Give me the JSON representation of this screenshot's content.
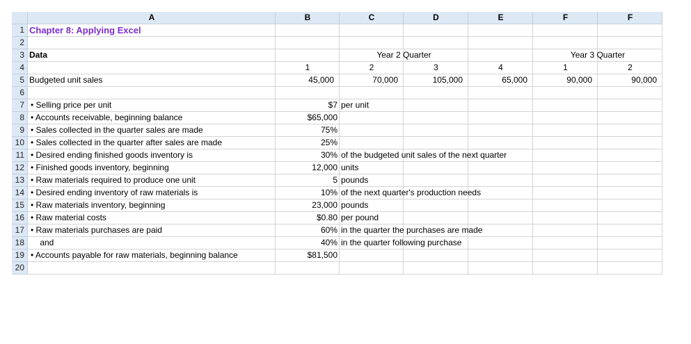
{
  "column_headers": [
    "A",
    "B",
    "C",
    "D",
    "E",
    "F",
    "F"
  ],
  "title": "Chapter 8: Applying Excel",
  "data_label": "Data",
  "year2_label": "Year 2 Quarter",
  "year3_label": "Year 3 Quarter",
  "quarters": [
    "1",
    "2",
    "3",
    "4",
    "1",
    "2"
  ],
  "budgeted_label": "Budgeted unit sales",
  "budgeted_sales": [
    "45,000",
    "70,000",
    "105,000",
    "65,000",
    "90,000",
    "90,000"
  ],
  "items": [
    {
      "row": "7",
      "label": "• Selling price per unit",
      "value": "$7",
      "note": "per unit"
    },
    {
      "row": "8",
      "label": "• Accounts receivable, beginning balance",
      "value": "$65,000",
      "note": ""
    },
    {
      "row": "9",
      "label": "• Sales collected in the quarter sales are made",
      "value": "75%",
      "note": ""
    },
    {
      "row": "10",
      "label": "• Sales collected in the quarter after sales are made",
      "value": "25%",
      "note": ""
    },
    {
      "row": "11",
      "label": "• Desired ending finished goods inventory is",
      "value": "30%",
      "note": "of the budgeted unit sales of the next quarter"
    },
    {
      "row": "12",
      "label": "• Finished goods inventory, beginning",
      "value": "12,000",
      "note": "units"
    },
    {
      "row": "13",
      "label": "• Raw materials required to produce one unit",
      "value": "5",
      "note": "pounds"
    },
    {
      "row": "14",
      "label": "• Desired ending inventory of raw materials is",
      "value": "10%",
      "note": "of the next quarter's production needs"
    },
    {
      "row": "15",
      "label": "• Raw materials inventory, beginning",
      "value": "23,000",
      "note": "pounds"
    },
    {
      "row": "16",
      "label": "• Raw material costs",
      "value": "$0.80",
      "note": "per pound"
    },
    {
      "row": "17",
      "label": "• Raw materials purchases are paid",
      "value": "60%",
      "note": "in the quarter the purchases are made"
    },
    {
      "row": "18",
      "label": "    and",
      "value": "40%",
      "note": "in the quarter following purchase"
    },
    {
      "row": "19",
      "label": "• Accounts payable for raw materials, beginning balance",
      "value": "$81,500",
      "note": ""
    }
  ],
  "row_numbers": [
    "1",
    "2",
    "3",
    "4",
    "5",
    "6",
    "7",
    "8",
    "9",
    "10",
    "11",
    "12",
    "13",
    "14",
    "15",
    "16",
    "17",
    "18",
    "19",
    "20"
  ]
}
